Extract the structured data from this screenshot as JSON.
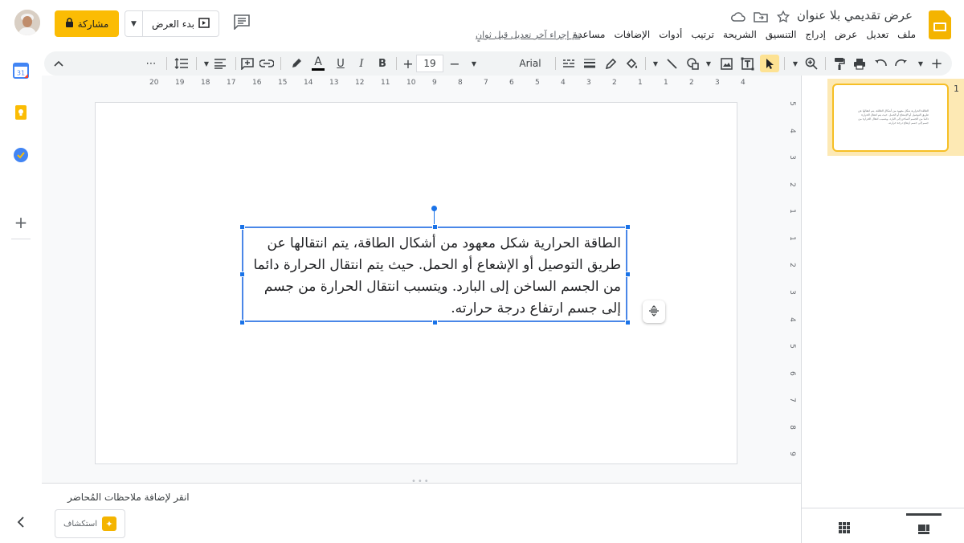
{
  "header": {
    "doc_title": "عرض تقديمي بلا عنوان",
    "menu": [
      "ملف",
      "تعديل",
      "عرض",
      "إدراج",
      "التنسيق",
      "الشريحة",
      "ترتيب",
      "أدوات",
      "الإضافات",
      "مساعدة"
    ],
    "last_edit": "تم إجراء آخر تعديل قبل ثوانٍ",
    "share_label": "مشاركة",
    "present_label": "بدء العرض"
  },
  "toolbar": {
    "font_name": "Arial",
    "font_size": "19",
    "bold": "B",
    "italic": "I",
    "underline": "U",
    "text_color": "A",
    "more": "⋯"
  },
  "slide": {
    "body_text": "الطاقة الحرارية شكل معهود من أشكال الطاقة، يتم انتقالها عن طريق التوصيل أو الإشعاع أو الحمل. حيث يتم انتقال الحرارة دائما من الجسم الساخن إلى البارد. ويتسبب انتقال الحرارة من جسم إلى جسم ارتفاع درجة حرارته."
  },
  "ruler": {
    "horizontal": [
      "20",
      "19",
      "18",
      "17",
      "16",
      "15",
      "14",
      "13",
      "12",
      "11",
      "10",
      "9",
      "8",
      "7",
      "6",
      "5",
      "4",
      "3",
      "2",
      "1",
      "1",
      "2",
      "3",
      "4"
    ],
    "vertical": [
      "5",
      "4",
      "3",
      "2",
      "1",
      "1",
      "2",
      "3",
      "4",
      "5",
      "6",
      "7",
      "8",
      "9"
    ]
  },
  "notes": {
    "placeholder": "انقر لإضافة ملاحظات المُحاضر",
    "explore_label": "استكشاف"
  },
  "filmstrip": {
    "slide_number": "1"
  },
  "colors": {
    "accent": "#fbbc04",
    "selection": "#4a87e8",
    "logo": "#f4b400"
  }
}
